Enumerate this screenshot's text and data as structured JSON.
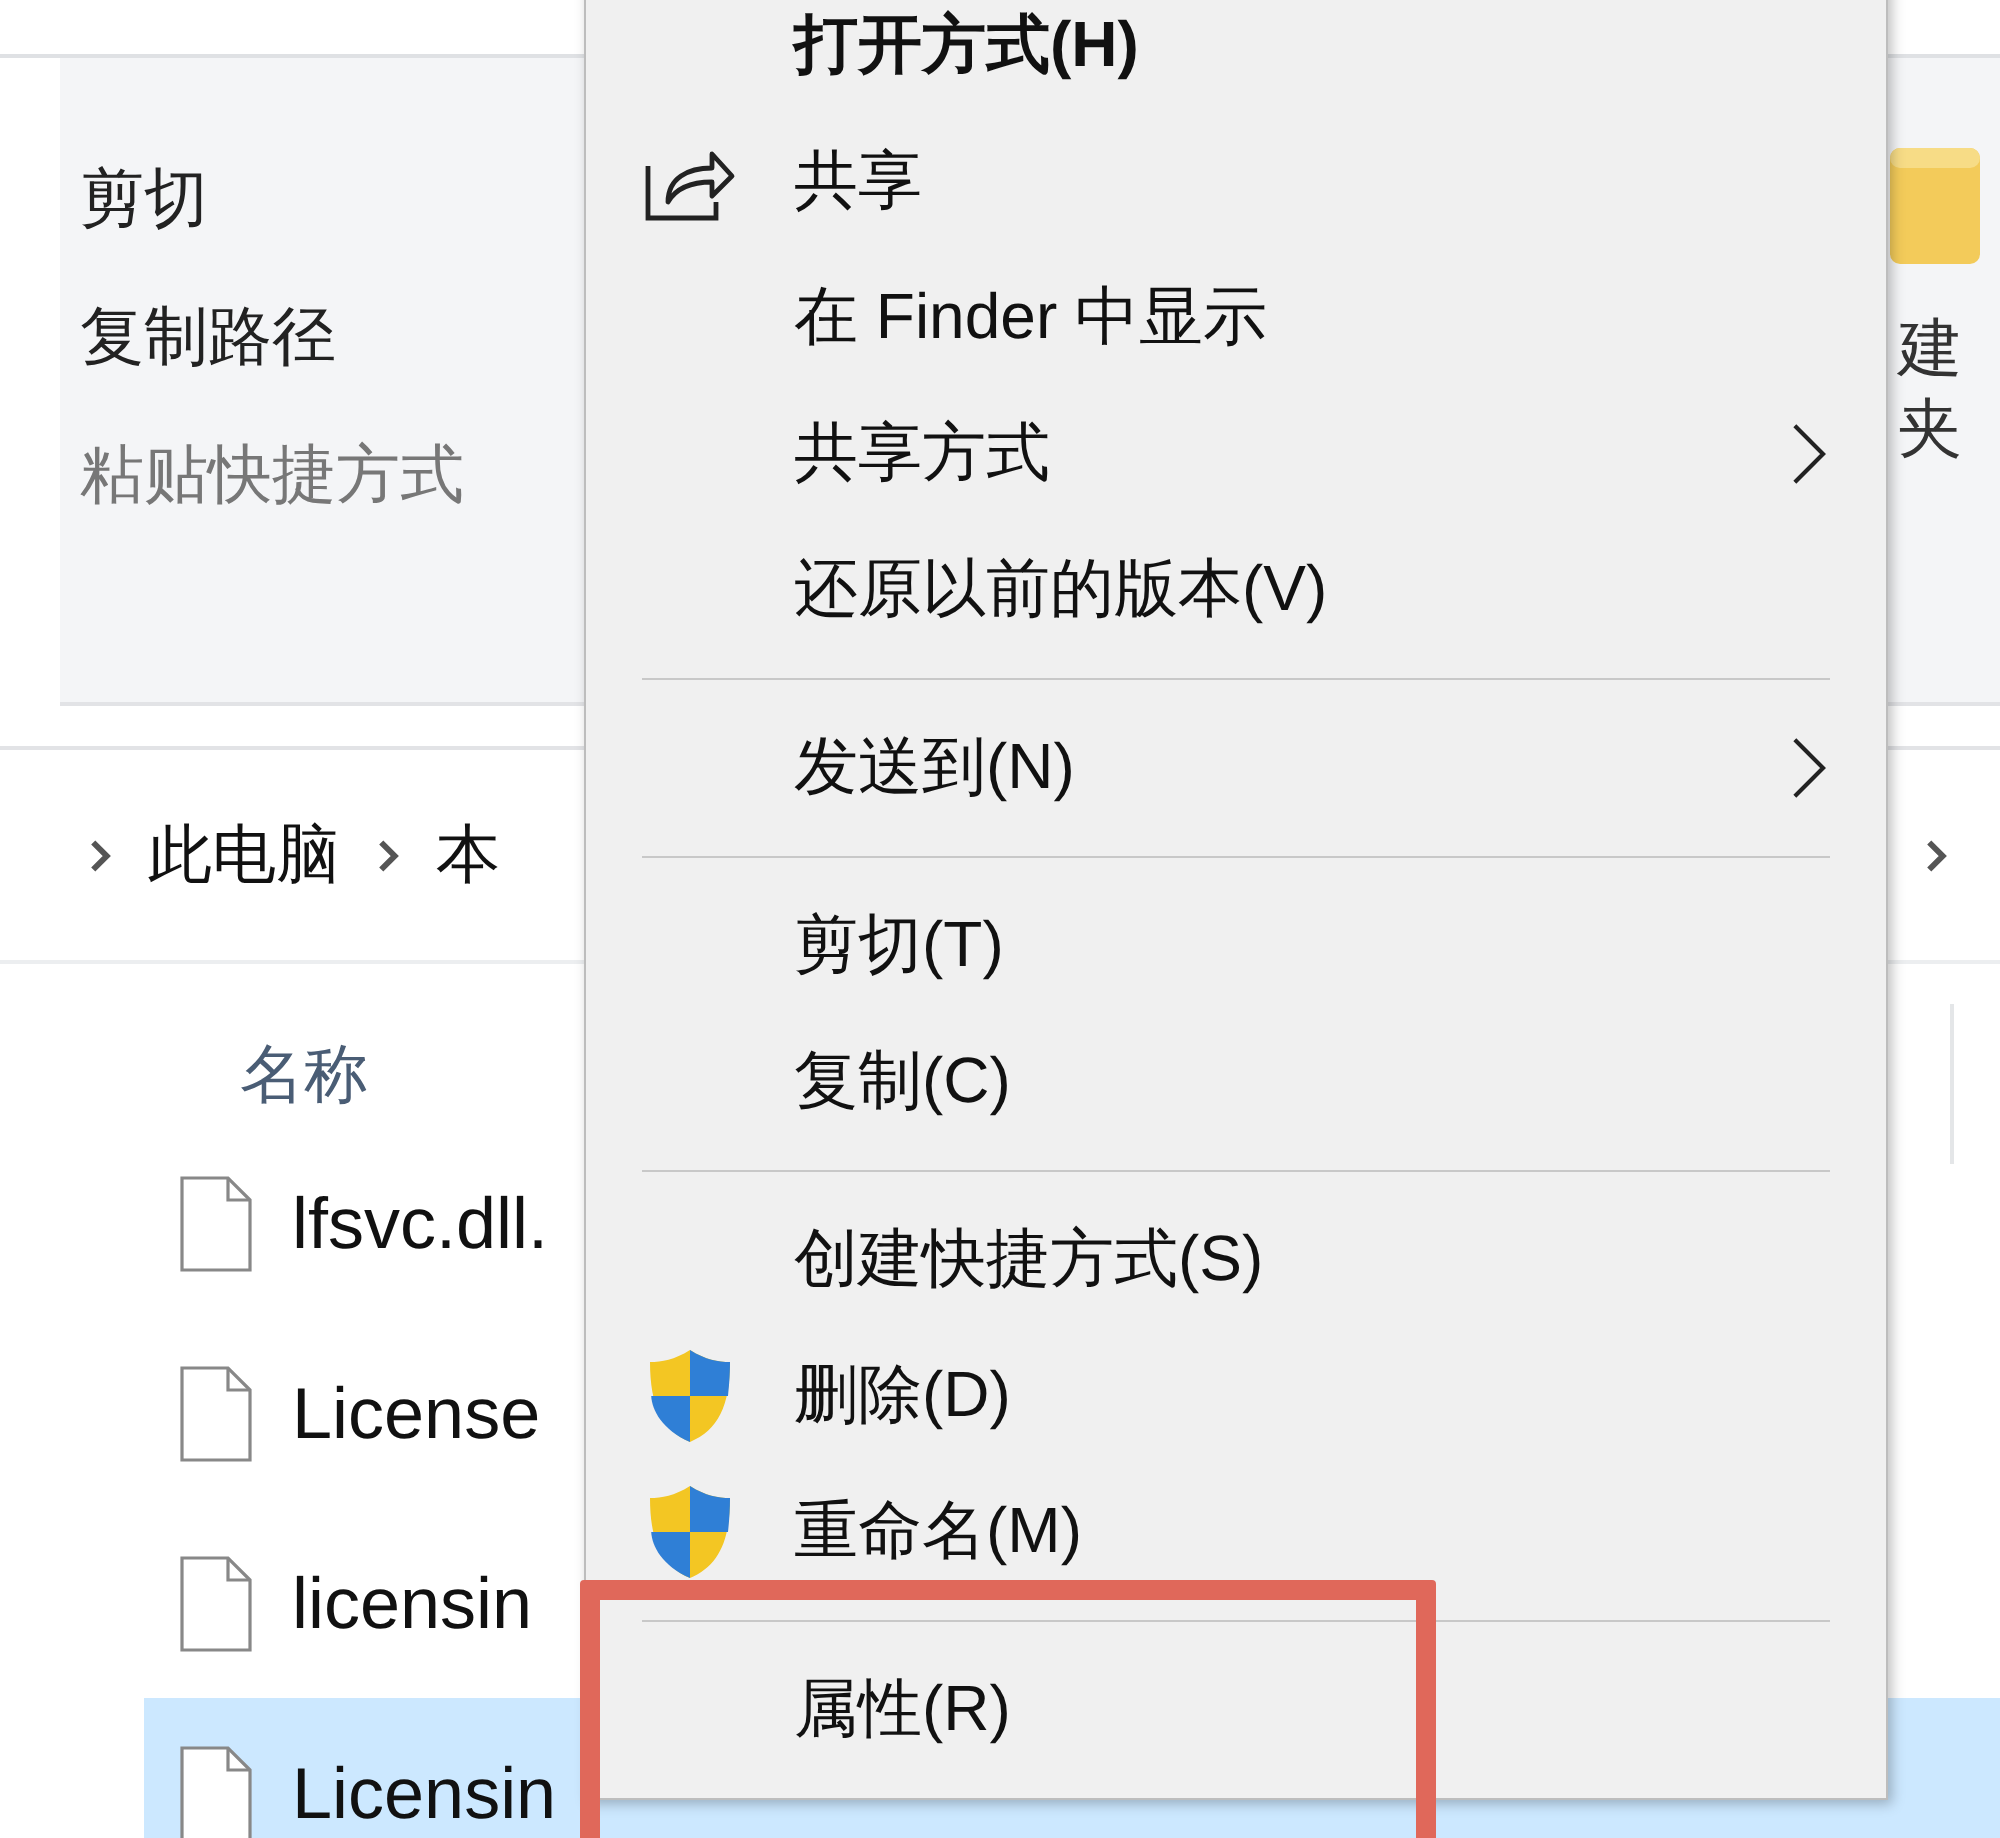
{
  "ribbon": {
    "commands": [
      {
        "label": "剪切",
        "disabled": false
      },
      {
        "label": "复制路径",
        "disabled": false
      },
      {
        "label": "粘贴快捷方式",
        "disabled": true
      }
    ],
    "new_folder_label": [
      "建",
      "夹"
    ]
  },
  "breadcrumb": [
    "此电脑",
    "本"
  ],
  "file_list": {
    "column_header": "名称",
    "rows": [
      {
        "name": "lfsvc.dll.",
        "selected": false
      },
      {
        "name": "License",
        "selected": false
      },
      {
        "name": "licensin",
        "selected": false
      },
      {
        "name": "Licensin",
        "selected": true
      }
    ]
  },
  "context_menu": {
    "items": [
      {
        "kind": "plain",
        "label": "打开方式(H)",
        "emphasized": true,
        "submenu": false,
        "highlighted": false
      },
      {
        "kind": "share",
        "label": "共享",
        "emphasized": false,
        "submenu": false,
        "highlighted": false
      },
      {
        "kind": "plain",
        "label": "在 Finder 中显示",
        "emphasized": false,
        "submenu": false,
        "highlighted": false
      },
      {
        "kind": "plain",
        "label": "共享方式",
        "emphasized": false,
        "submenu": true,
        "highlighted": false
      },
      {
        "kind": "plain",
        "label": "还原以前的版本(V)",
        "emphasized": false,
        "submenu": false,
        "highlighted": false
      },
      {
        "kind": "separator"
      },
      {
        "kind": "plain",
        "label": "发送到(N)",
        "emphasized": false,
        "submenu": true,
        "highlighted": false
      },
      {
        "kind": "separator"
      },
      {
        "kind": "plain",
        "label": "剪切(T)",
        "emphasized": false,
        "submenu": false,
        "highlighted": false
      },
      {
        "kind": "plain",
        "label": "复制(C)",
        "emphasized": false,
        "submenu": false,
        "highlighted": false
      },
      {
        "kind": "separator"
      },
      {
        "kind": "plain",
        "label": "创建快捷方式(S)",
        "emphasized": false,
        "submenu": false,
        "highlighted": false
      },
      {
        "kind": "shield",
        "label": "删除(D)",
        "emphasized": false,
        "submenu": false,
        "highlighted": false
      },
      {
        "kind": "shield",
        "label": "重命名(M)",
        "emphasized": false,
        "submenu": false,
        "highlighted": false
      },
      {
        "kind": "separator"
      },
      {
        "kind": "plain",
        "label": "属性(R)",
        "emphasized": false,
        "submenu": false,
        "highlighted": true
      }
    ]
  }
}
